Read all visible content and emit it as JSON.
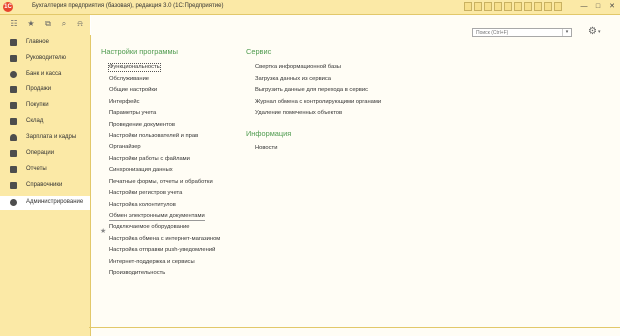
{
  "window": {
    "title": "Бухгалтерия предприятия (базовая), редакция 3.0  (1С:Предприятие)",
    "logo": "1С",
    "controls": [
      "minimize-icon",
      "maximize-icon",
      "close-icon"
    ],
    "minimize_glyph": "—",
    "maximize_glyph": "□",
    "close_glyph": "✕"
  },
  "toolbar": {
    "icons": [
      "apps-grid-icon",
      "star-icon",
      "history-icon",
      "search-icon",
      "bell-icon"
    ],
    "grid_glyph": "☷",
    "star_glyph": "★",
    "history_glyph": "⧉",
    "search_glyph": "⌕",
    "bell_glyph": "⍾"
  },
  "sidebar": {
    "items": [
      {
        "label": "Главное",
        "icon": "menu-icon"
      },
      {
        "label": "Руководителю",
        "icon": "chart-icon"
      },
      {
        "label": "Банк и касса",
        "icon": "bank-icon"
      },
      {
        "label": "Продажи",
        "icon": "sales-icon"
      },
      {
        "label": "Покупки",
        "icon": "cart-icon"
      },
      {
        "label": "Склад",
        "icon": "warehouse-icon"
      },
      {
        "label": "Зарплата и кадры",
        "icon": "person-icon"
      },
      {
        "label": "Операции",
        "icon": "operations-icon"
      },
      {
        "label": "Отчеты",
        "icon": "reports-icon"
      },
      {
        "label": "Справочники",
        "icon": "book-icon"
      },
      {
        "label": "Администрирование",
        "icon": "gear-icon",
        "active": true
      }
    ]
  },
  "search": {
    "placeholder": "Поиск (Ctrl+F)",
    "dropdown_glyph": "▾"
  },
  "settings_glyph": "⚙",
  "settings_drop": "▾",
  "favorite_glyph": "★",
  "sections": {
    "program_settings": {
      "title": "Настройки программы",
      "items": [
        "Функциональность",
        "Обслуживание",
        "Общие настройки",
        "Интерфейс",
        "Параметры учета",
        "Проведение документов",
        "Настройки пользователей и прав",
        "Органайзер",
        "Настройки работы с файлами",
        "Синхронизация данных",
        "Печатные формы, отчеты и обработки",
        "Настройки регистров учета",
        "Настройка колонтитулов",
        "Обмен электронными документами",
        "Подключаемое оборудование",
        "Настройка обмена с интернет-магазином",
        "Настройка отправки push-уведомлений",
        "Интернет-поддержка и сервисы",
        "Производительность"
      ]
    },
    "service": {
      "title": "Сервис",
      "items": [
        "Свертка информационной базы",
        "Загрузка данных из сервиса",
        "Выгрузить данные для перехода в сервис",
        "Журнал обмена с контролирующими органами",
        "Удаление помеченных объектов"
      ]
    },
    "information": {
      "title": "Информация",
      "items": [
        "Новости"
      ]
    }
  }
}
